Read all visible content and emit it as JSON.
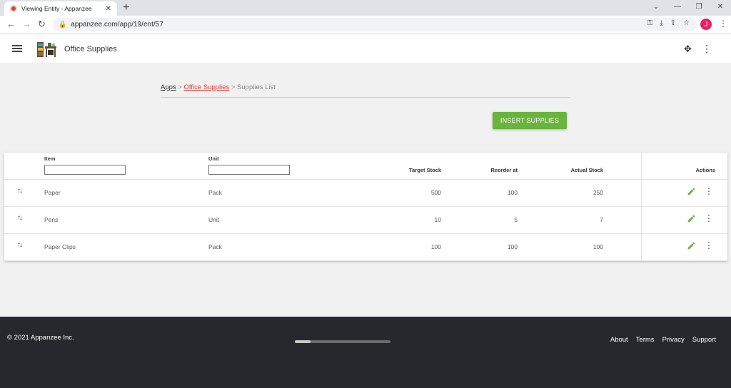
{
  "browser": {
    "tab_title": "Viewing Entity - Appanzee",
    "tab_close": "✕",
    "new_tab": "+",
    "url": "appanzee.com/app/19/ent/57",
    "profile_initial": "J"
  },
  "app": {
    "title": "Office Supplies"
  },
  "breadcrumb": {
    "apps": "Apps",
    "sep1": " > ",
    "office_supplies": "Office Supplies",
    "sep2": " > ",
    "current": "Supplies List"
  },
  "insert_button": "INSERT SUPPLIES",
  "table": {
    "headers": {
      "item": "Item",
      "unit": "Unit",
      "target_stock": "Target Stock",
      "reorder_at": "Reorder at",
      "actual_stock": "Actual Stock",
      "actions": "Actions"
    },
    "rows": [
      {
        "item": "Paper",
        "unit": "Pack",
        "target_stock": "500",
        "reorder_at": "100",
        "actual_stock": "250"
      },
      {
        "item": "Pens",
        "unit": "Unit",
        "target_stock": "10",
        "reorder_at": "5",
        "actual_stock": "7"
      },
      {
        "item": "Paper Clips",
        "unit": "Pack",
        "target_stock": "100",
        "reorder_at": "100",
        "actual_stock": "100"
      }
    ]
  },
  "footer": {
    "copyright": "© 2021 Appanzee Inc.",
    "links": [
      "About",
      "Terms",
      "Privacy",
      "Support"
    ]
  },
  "colors": {
    "accent_green": "#6ab33d",
    "breadcrumb_link": "#e53935",
    "footer_bg": "#26282e"
  }
}
